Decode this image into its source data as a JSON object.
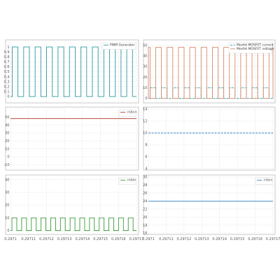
{
  "figure": {
    "background": "#ffffff",
    "frame_color": "#bbbbbb",
    "grid_color": "#d8d8d8",
    "tick_color": "#555555"
  },
  "chart_data": [
    {
      "type": "line",
      "title": "",
      "xlabel": "",
      "ylabel": "",
      "grid": true,
      "legend_position": "top-right",
      "xlim": [
        0,
        1
      ],
      "ylim": [
        -0.1,
        1.1
      ],
      "yticks": [
        0,
        0.1,
        0.2,
        0.3,
        0.4,
        0.5,
        0.6,
        0.7,
        0.8,
        0.9,
        1
      ],
      "ytick_labels": [
        "0",
        "0.1",
        "0.2",
        "0.3",
        "0.4",
        "0.5",
        "0.6",
        "0.7",
        "0.8",
        "0.9",
        "1"
      ],
      "series": [
        {
          "name": "PWM Generator",
          "color": "#2e9aa0",
          "dash": "none",
          "kind": "pulse",
          "periods": 11,
          "duty": 0.5,
          "low": 0,
          "high": 1
        }
      ]
    },
    {
      "type": "line",
      "title": "",
      "xlabel": "",
      "ylabel": "",
      "grid": true,
      "legend_position": "top-right",
      "xlim": [
        0,
        1
      ],
      "ylim": [
        -3,
        53
      ],
      "yticks": [
        0,
        10,
        20,
        30,
        40,
        50
      ],
      "ytick_labels": [
        "0",
        "10",
        "20",
        "30",
        "40",
        "50"
      ],
      "series": [
        {
          "name": "Mosfet MOSFET current",
          "color": "#2e9aa0",
          "dash": "3,1.5",
          "kind": "pulse",
          "periods": 11,
          "duty": 0.5,
          "low": 0,
          "high": 10
        },
        {
          "name": "Mosfet MOSFET voltage",
          "color": "#d68a6a",
          "dash": "none",
          "kind": "pulse",
          "periods": 11,
          "duty": 0.5,
          "low": 0,
          "high": 48,
          "phase": 0.5
        }
      ]
    },
    {
      "type": "line",
      "title": "",
      "xlabel": "",
      "ylabel": "",
      "grid": true,
      "legend_position": "top-right",
      "xlim": [
        0,
        1
      ],
      "ylim": [
        -15,
        60
      ],
      "yticks": [
        -10,
        0,
        10,
        20,
        30,
        40,
        50
      ],
      "ytick_labels": [
        "-10",
        "0",
        "10",
        "20",
        "30",
        "40",
        "50"
      ],
      "series": [
        {
          "name": "<Uin>",
          "color": "#b33a2a",
          "dash": "none",
          "kind": "constant",
          "value": 48
        }
      ]
    },
    {
      "type": "line",
      "title": "",
      "xlabel": "",
      "ylabel": "",
      "grid": true,
      "legend_position": "top-right",
      "xlim": [
        0,
        1
      ],
      "ylim": [
        4,
        14
      ],
      "yticks": [
        4,
        6,
        8,
        10,
        12,
        14
      ],
      "ytick_labels": [
        "4",
        "6",
        "8",
        "10",
        "12",
        "14"
      ],
      "series": [
        {
          "name": "",
          "color": "#2e7ec0",
          "dash": "3,1.5",
          "kind": "constant",
          "value": 10
        }
      ]
    },
    {
      "type": "line",
      "title": "",
      "xlabel": "",
      "ylabel": "",
      "grid": true,
      "legend_position": "top-right",
      "xlim": [
        0,
        1
      ],
      "ylim": [
        -2,
        42
      ],
      "yticks": [
        0,
        10,
        20,
        30,
        40
      ],
      "ytick_labels": [
        "0",
        "10",
        "20",
        "30",
        "40"
      ],
      "series": [
        {
          "name": "<Ud>",
          "color": "#3a9a3a",
          "dash": "none",
          "kind": "pulse",
          "periods": 13,
          "duty": 0.5,
          "low": 0,
          "high": 10
        }
      ]
    },
    {
      "type": "line",
      "title": "",
      "xlabel": "",
      "ylabel": "",
      "grid": true,
      "legend_position": "top-right",
      "xlim": [
        0,
        1
      ],
      "ylim": [
        16,
        30
      ],
      "yticks": [
        16,
        18,
        20,
        22,
        24,
        26,
        28,
        30
      ],
      "ytick_labels": [
        "16",
        "18",
        "20",
        "22",
        "24",
        "26",
        "28",
        "30"
      ],
      "series": [
        {
          "name": "<Uo>",
          "color": "#2e7ec0",
          "dash": "none",
          "kind": "constant",
          "value": 24
        }
      ]
    }
  ],
  "x_axis": {
    "tick_labels": [
      "0.2971",
      "0.29711",
      "0.29712",
      "0.29713",
      "0.29714",
      "0.29715",
      "0.29716",
      "0.29717"
    ]
  }
}
